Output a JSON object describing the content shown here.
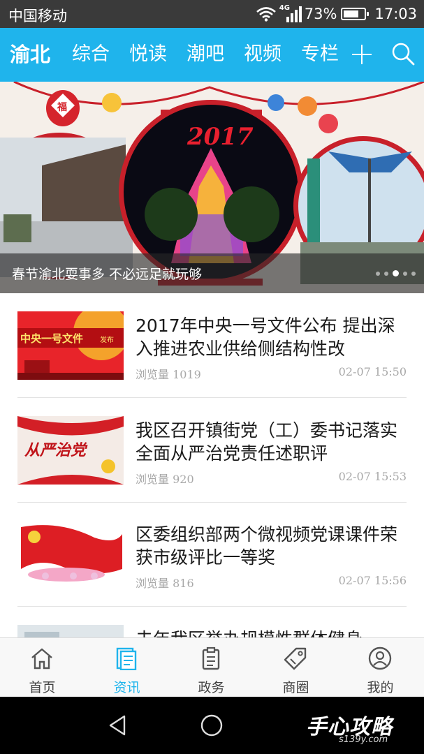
{
  "status_bar": {
    "carrier": "中国移动",
    "network": "4G",
    "battery": "73%",
    "battery_level": 0.73,
    "time": "17:03"
  },
  "top_nav": {
    "tabs": [
      {
        "label": "渝北",
        "active": true
      },
      {
        "label": "综合",
        "active": false
      },
      {
        "label": "悦读",
        "active": false
      },
      {
        "label": "潮吧",
        "active": false
      },
      {
        "label": "视频",
        "active": false
      },
      {
        "label": "专栏",
        "active": false
      }
    ],
    "add_icon": "plus-icon",
    "search_icon": "search-icon",
    "color": "#1fb4ec"
  },
  "banner": {
    "caption": "春节渝北耍事多 不必远足就玩够",
    "image_text": "2017",
    "seal_text": "福",
    "dots": 5,
    "active_dot": 3
  },
  "news": [
    {
      "title": "2017年中央一号文件公布 提出深入推进农业供给侧结构性改",
      "views": "浏览量 1019",
      "time": "02-07 15:50",
      "thumb_text": "中央一号文件",
      "thumb_sub": "发布"
    },
    {
      "title": "我区召开镇街党（工）委书记落实全面从严治党责任述职评",
      "views": "浏览量 920",
      "time": "02-07 15:53",
      "thumb_text": "从严治党"
    },
    {
      "title": "区委组织部两个微视频党课课件荣获市级评比一等奖",
      "views": "浏览量 816",
      "time": "02-07 15:56"
    },
    {
      "title": "去年我区举办规模性群体健身",
      "views": "",
      "time": ""
    }
  ],
  "bottom_tabs": [
    {
      "label": "首页",
      "icon": "home-icon",
      "active": false
    },
    {
      "label": "资讯",
      "icon": "news-icon",
      "active": true
    },
    {
      "label": "政务",
      "icon": "clipboard-icon",
      "active": false
    },
    {
      "label": "商圈",
      "icon": "tag-icon",
      "active": false
    },
    {
      "label": "我的",
      "icon": "user-icon",
      "active": false
    }
  ],
  "watermark": {
    "text": "手心攻略",
    "sub": "s139y.com"
  }
}
